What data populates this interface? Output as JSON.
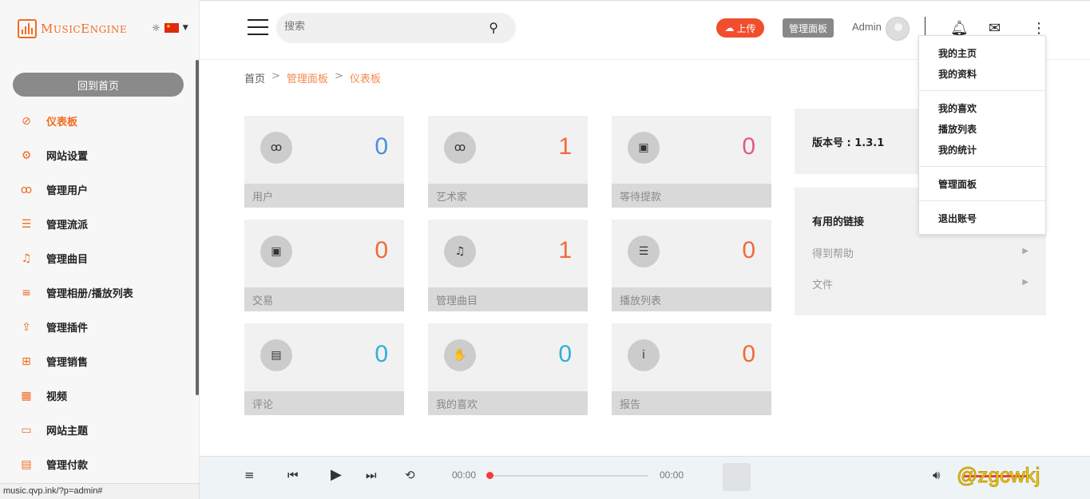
{
  "brand": {
    "name_first": "M",
    "name_first_rest": "USIC",
    "name_second": "E",
    "name_second_rest": "NGINE"
  },
  "sidebar": {
    "home_button": "回到首页",
    "items": [
      {
        "label": "仪表板",
        "icon": "dashboard-icon",
        "glyph": "⊘",
        "active": true
      },
      {
        "label": "网站设置",
        "icon": "gear-icon",
        "glyph": "⚙"
      },
      {
        "label": "管理用户",
        "icon": "users-icon",
        "glyph": "ꝏ"
      },
      {
        "label": "管理流派",
        "icon": "list-icon",
        "glyph": "☰"
      },
      {
        "label": "管理曲目",
        "icon": "music-note-icon",
        "glyph": "♫"
      },
      {
        "label": "管理相册/播放列表",
        "icon": "playlist-icon",
        "glyph": "≡"
      },
      {
        "label": "管理插件",
        "icon": "upload-icon",
        "glyph": "⇪"
      },
      {
        "label": "管理销售",
        "icon": "cart-icon",
        "glyph": "⊞"
      },
      {
        "label": "视频",
        "icon": "film-icon",
        "glyph": "▦"
      },
      {
        "label": "网站主题",
        "icon": "monitor-icon",
        "glyph": "▭"
      },
      {
        "label": "管理付款",
        "icon": "payment-icon",
        "glyph": "▤"
      }
    ]
  },
  "header": {
    "search_placeholder": "搜索",
    "upload_label": "上传",
    "admin_panel_label": "管理面板",
    "username": "Admin"
  },
  "dropdown": {
    "items": [
      "我的主页",
      "我的资料",
      "我的喜欢",
      "播放列表",
      "我的统计",
      "管理面板",
      "退出账号"
    ]
  },
  "breadcrumb": {
    "home": "首页",
    "sep": ">",
    "panel": "管理面板",
    "current": "仪表板"
  },
  "cards": [
    {
      "label": "用户",
      "value": "0",
      "icon": "users-icon",
      "glyph": "ꝏ",
      "color": "#4a90d9"
    },
    {
      "label": "艺术家",
      "value": "1",
      "icon": "artists-icon",
      "glyph": "ꝏ",
      "color": "#f06a3a"
    },
    {
      "label": "等待提款",
      "value": "0",
      "icon": "money-icon",
      "glyph": "▣",
      "color": "#e05a8a"
    },
    {
      "label": "交易",
      "value": "0",
      "icon": "money-icon",
      "glyph": "▣",
      "color": "#f06a3a"
    },
    {
      "label": "管理曲目",
      "value": "1",
      "icon": "music-note-icon",
      "glyph": "♫",
      "color": "#f06a3a"
    },
    {
      "label": "播放列表",
      "value": "0",
      "icon": "list-icon",
      "glyph": "☰",
      "color": "#f06a3a"
    },
    {
      "label": "评论",
      "value": "0",
      "icon": "comment-icon",
      "glyph": "▤",
      "color": "#30b0d8"
    },
    {
      "label": "我的喜欢",
      "value": "0",
      "icon": "thumbs-up-icon",
      "glyph": "✋",
      "color": "#30b0d8"
    },
    {
      "label": "报告",
      "value": "0",
      "icon": "info-icon",
      "glyph": "i",
      "color": "#f06a3a"
    }
  ],
  "version": {
    "label": "版本号 : 1.3.1"
  },
  "useful_links": {
    "title": "有用的链接",
    "items": [
      "得到帮助",
      "文件"
    ]
  },
  "player": {
    "time_current": "00:00",
    "time_total": "00:00"
  },
  "status_url": "music.qvp.ink/?p=admin#",
  "watermark": "@zgcwkj"
}
